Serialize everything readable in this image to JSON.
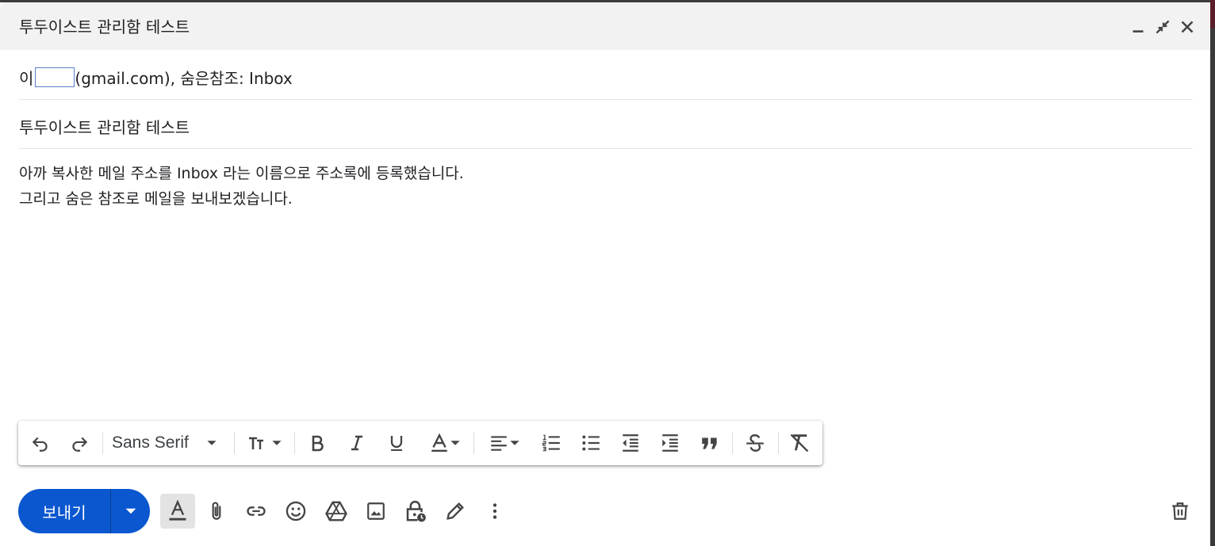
{
  "title": "투두이스트 관리함 테스트",
  "recipients": {
    "prefix": "이",
    "suffix": "(gmail.com), 숨은참조: Inbox"
  },
  "subject": "투두이스트 관리함 테스트",
  "body": {
    "line1": "아까 복사한 메일 주소를 Inbox 라는 이름으로 주소록에 등록했습니다.",
    "line2": "그리고 숨은 참조로 메일을 보내보겠습니다."
  },
  "formatting": {
    "font": "Sans Serif",
    "icons": [
      "undo-icon",
      "redo-icon",
      "text-size-icon",
      "bold-icon",
      "italic-icon",
      "underline-icon",
      "text-color-icon",
      "align-icon",
      "numbered-list-icon",
      "bulleted-list-icon",
      "indent-less-icon",
      "indent-more-icon",
      "quote-icon",
      "strikethrough-icon",
      "remove-formatting-icon"
    ]
  },
  "send": {
    "label": "보내기"
  },
  "colors": {
    "accent": "#0b57d0",
    "titlebar": "#f2f2f2"
  }
}
